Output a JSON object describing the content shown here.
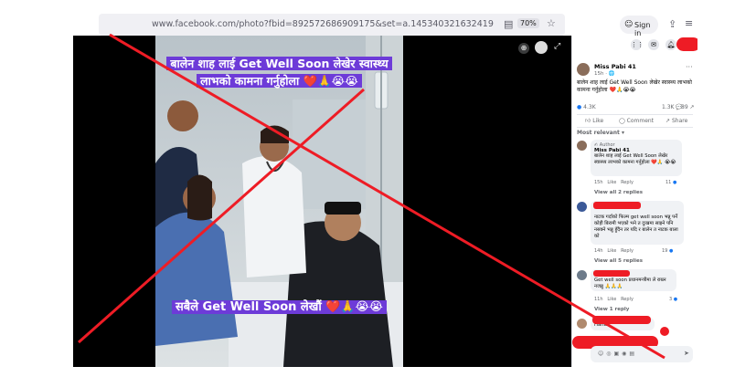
{
  "browser": {
    "url": "www.facebook.com/photo?fbid=892572686909175&set=a.145340321632419",
    "zoom": "70%",
    "sign_in": "Sign in"
  },
  "photo": {
    "caption_top": "बालेन शाह लाई Get Well Soon लेखेर स्वास्थ्य लाभको कामना गर्नुहोला ❤️🙏😭😭",
    "caption_bottom": "सबैले Get Well Soon लेखौं ❤️🙏😭😭"
  },
  "post": {
    "author": "Miss Pabi 41",
    "time": "15h · 🌐",
    "text": "बालेन शाह लाई Get Well Soon लेखेर स्वास्थ्य लाभको कामना गर्नुहोला ❤️🙏😭😭",
    "reactions": "4.3K",
    "comments_count": "1.3K 💬",
    "shares_count": "89 ↗",
    "like": "Like",
    "comment": "Comment",
    "share": "Share",
    "sort": "Most relevant ▾"
  },
  "comments": [
    {
      "badge": "✍ Author",
      "author": "Miss Pabi 41",
      "text": "बालेन शाह लाई Get Well Soon लेखेर स्वास्थ्य लाभको कामना गर्नुहोला ❤️🙏 😭😭",
      "time": "15h",
      "like": "Like",
      "reply": "Reply",
      "count": "11",
      "replies": "View all 2 replies"
    },
    {
      "author": "",
      "text": "नाटक गर्दाको फिल्म get well soon भन्नु पर्ने कोही बिरामी भएको भने त दुःखमा साझ्ने पनि नसक्ने भन्नु हुँदैन तर यदि र बालेन त नाटक बाला को",
      "time": "14h",
      "like": "Like",
      "reply": "Reply",
      "count": "19",
      "replies": "View all 5 replies"
    },
    {
      "author": "",
      "text": "Get well soon प्रधानमन्त्रीमा ले राख्न नजन्नु 🙏🙏🙏",
      "time": "11h",
      "like": "Like",
      "reply": "Reply",
      "count": "3",
      "replies": "View 1 reply"
    },
    {
      "author": "",
      "text": "Haha...",
      "time": "",
      "like": "",
      "reply": "",
      "count": "",
      "replies": ""
    }
  ],
  "colors": {
    "overlay_red": "#ee1c25",
    "caption_bg": "#6d3bd8",
    "fb_blue": "#1877f2"
  }
}
